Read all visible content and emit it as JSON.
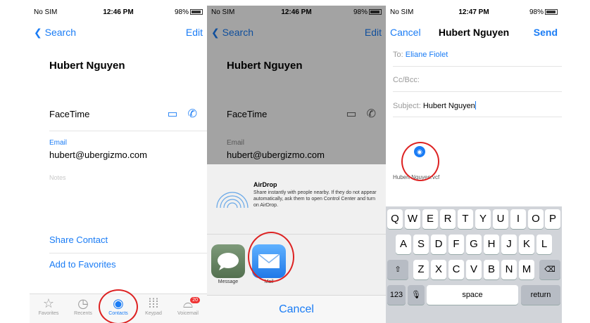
{
  "status": {
    "carrier": "No SIM",
    "battery": "98%",
    "times": [
      "12:46 PM",
      "12:46 PM",
      "12:47 PM"
    ]
  },
  "contact_screen": {
    "back_label": "Search",
    "edit_label": "Edit",
    "name": "Hubert Nguyen",
    "facetime_label": "FaceTime",
    "email_caption": "Email",
    "email_value": "hubert@ubergizmo.com",
    "notes_label": "Notes",
    "share_contact": "Share Contact",
    "add_to_favorites": "Add to Favorites"
  },
  "tabbar": {
    "tabs": [
      {
        "label": "Favorites",
        "icon": "star-icon"
      },
      {
        "label": "Recents",
        "icon": "clock-icon"
      },
      {
        "label": "Contacts",
        "icon": "person-icon"
      },
      {
        "label": "Keypad",
        "icon": "keypad-icon"
      },
      {
        "label": "Voicemail",
        "icon": "voicemail-icon"
      }
    ],
    "voicemail_badge": "20"
  },
  "share_sheet": {
    "airdrop_title": "AirDrop",
    "airdrop_text": "Share instantly with people nearby. If they do not appear automatically, ask them to open Control Center and turn on AirDrop.",
    "apps": [
      {
        "label": "Message",
        "icon": "message-icon"
      },
      {
        "label": "Mail",
        "icon": "mail-icon"
      }
    ],
    "cancel": "Cancel"
  },
  "compose": {
    "cancel": "Cancel",
    "title": "Hubert Nguyen",
    "send": "Send",
    "to_label": "To:",
    "to_value": "Eliane Fiolet",
    "ccbcc_label": "Cc/Bcc:",
    "subject_label": "Subject:",
    "subject_value": "Hubert Nguyen",
    "attachment_name": "Hubert Nguyen.vcf"
  },
  "keyboard": {
    "row1": [
      "Q",
      "W",
      "E",
      "R",
      "T",
      "Y",
      "U",
      "I",
      "O",
      "P"
    ],
    "row2": [
      "A",
      "S",
      "D",
      "F",
      "G",
      "H",
      "J",
      "K",
      "L"
    ],
    "row3": [
      "Z",
      "X",
      "C",
      "V",
      "B",
      "N",
      "M"
    ],
    "numbers_key": "123",
    "space_key": "space",
    "return_key": "return"
  },
  "colors": {
    "ios_blue": "#1a7cf5",
    "highlight_red": "#d22222"
  }
}
